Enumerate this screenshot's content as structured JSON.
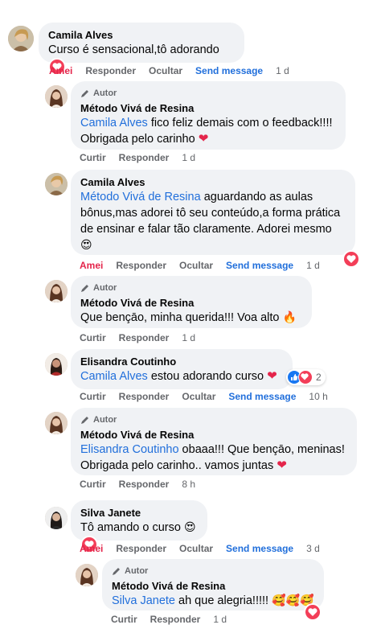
{
  "actions": {
    "love": "Amei",
    "like": "Curtir",
    "reply": "Responder",
    "hide": "Ocultar",
    "send_message": "Send message"
  },
  "author_badge": "Autor",
  "comments": [
    {
      "name": "Camila Alves",
      "text": "Curso é sensacional,tô adorando",
      "time": "1 d"
    },
    {
      "name": "Método Vivá de Resina",
      "mention": "Camila Alves",
      "text": " fico feliz demais com o feedback!!!!",
      "text2": "Obrigada pelo carinho",
      "time": "1 d"
    },
    {
      "name": "Camila Alves",
      "mention": "Método Vivá de Resina",
      "text": " aguardando as aulas",
      "text2": "bônus,mas adorei tô seu conteúdo,a forma prática",
      "text3": "de ensinar e falar tão claramente. Adorei mesmo",
      "emoji": "😍",
      "time": "1 d"
    },
    {
      "name": "Método Vivá de Resina",
      "text": "Que bençāo, minha querida!!! Voa alto",
      "emoji": "🔥",
      "time": "1 d"
    },
    {
      "name": "Elisandra Coutinho",
      "mention": "Camila Alves",
      "text": " estou adorando curso",
      "reactions_count": "2",
      "time": "10 h"
    },
    {
      "name": "Método Vivá de Resina",
      "mention": "Elisandra Coutinho",
      "text": " obaaa!!! Que bençāo, meninas!",
      "text2": "Obrigada pelo carinho.. vamos juntas",
      "time": "8 h"
    },
    {
      "name": "Silva Janete",
      "text": "Tô amando o curso",
      "emoji": "😍",
      "time": "3 d"
    },
    {
      "name": "Método Vivá de Resina",
      "mention": "Silva Janete",
      "text": " ah que alegria!!!!!",
      "emoji": "🥰🥰🥰",
      "time": "1 d"
    }
  ],
  "colors": {
    "love": "#e4254b",
    "link": "#216fdb",
    "bubble": "#f0f2f5",
    "muted": "#65676b"
  }
}
